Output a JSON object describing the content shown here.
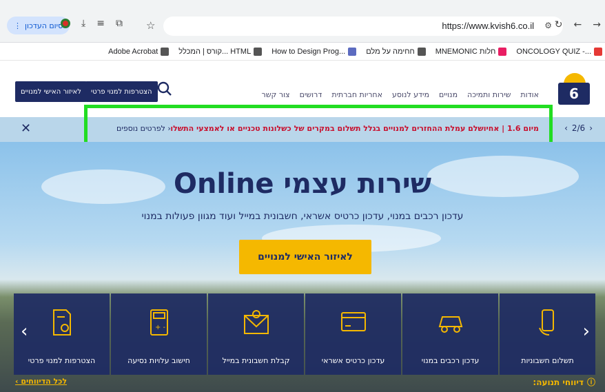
{
  "browser": {
    "update_button": "סיום העדכון",
    "url": "https://www.kvish6.co.il",
    "bookmarks": [
      {
        "label": "ONCOLOGY QUIZ -...",
        "color": "#e53935"
      },
      {
        "label": "MNEMONIC חלות",
        "color": "#e91e63"
      },
      {
        "label": "חחימה על מלם",
        "color": "#555555"
      },
      {
        "label": "How to Design Prog...",
        "color": "#5c6bc0"
      },
      {
        "label": "קורס | המכלל... HTML",
        "color": "#555555"
      },
      {
        "label": "Adobe Acrobat",
        "color": "#555555"
      }
    ]
  },
  "header": {
    "logo_text": "6",
    "nav": [
      "אודות",
      "שירות ותמיכה",
      "מנויים",
      "מידע לנוסע",
      "אחריות חברתית",
      "דרושים",
      "צור קשר"
    ],
    "join_button": "הצטרפות למנוי פרטי",
    "personal_button": "לאיזור האישי למנויים"
  },
  "banner": {
    "pager": "2/6",
    "text": "מיום 1.6 | אחיושלם עמלת ההחזרים למנויים בגלל תשלום במקרים של כשלונות טכניים או לאמצעי התשלום,",
    "more": "לפרטים נוספים ›"
  },
  "hero": {
    "title": "שירות עצמי Online",
    "subtitle": "עדכון רכבים במנוי, עדכון כרטיס אשראי, חשבונית במייל ועוד מגוון פעולות במנוי",
    "cta": "לאיזור האישי למנויים"
  },
  "cards": [
    {
      "label": "תשלום חשבוניות",
      "icon": "hand-phone-icon"
    },
    {
      "label": "עדכון רכבים במנוי",
      "icon": "car-icon"
    },
    {
      "label": "עדכון כרטיס אשראי",
      "icon": "credit-card-icon"
    },
    {
      "label": "קבלת חשבונית במייל",
      "icon": "envelope-icon"
    },
    {
      "label": "חישוב עלויות נסיעה",
      "icon": "calculator-icon"
    },
    {
      "label": "הצטרפות למנוי פרטי",
      "icon": "document-user-icon"
    }
  ],
  "footer": {
    "reports": "דיווחי תנועה:",
    "all_reports": "לכל הדיווחים ›"
  },
  "colors": {
    "brand_navy": "#1e2b63",
    "brand_yellow": "#f5b800",
    "banner_red": "#c8102e",
    "highlight": "#22dd22"
  }
}
